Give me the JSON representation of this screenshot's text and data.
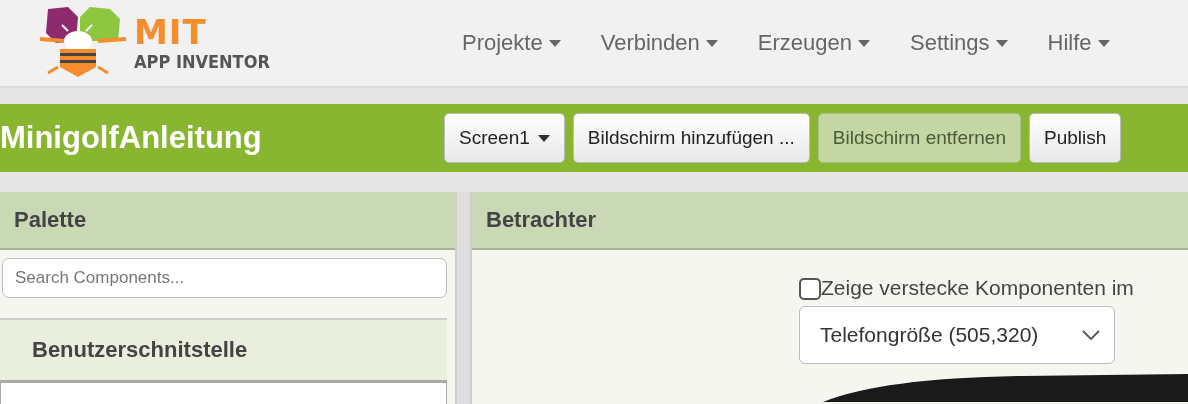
{
  "logo": {
    "title": "MIT",
    "subtitle": "APP INVENTOR"
  },
  "nav": [
    {
      "label": "Projekte"
    },
    {
      "label": "Verbinden"
    },
    {
      "label": "Erzeugen"
    },
    {
      "label": "Settings"
    },
    {
      "label": "Hilfe"
    }
  ],
  "project": {
    "title": "MinigolfAnleitung",
    "buttons": [
      {
        "label": "Screen1",
        "kind": "dropdown",
        "disabled": false
      },
      {
        "label": "Bildschirm hinzufügen ...",
        "kind": "plain",
        "disabled": false
      },
      {
        "label": "Bildschirm entfernen",
        "kind": "plain",
        "disabled": true
      },
      {
        "label": "Publish",
        "kind": "plain",
        "disabled": false
      }
    ]
  },
  "palette": {
    "title": "Palette",
    "search": {
      "placeholder": "Search Components..."
    },
    "category": "Benutzerschnitstelle"
  },
  "viewer": {
    "title": "Betrachter",
    "hidden_components": {
      "label": "Zeige verstecke Komponenten im",
      "checked": false
    },
    "size_select": {
      "value": "Telefongröße (505,320)"
    }
  }
}
